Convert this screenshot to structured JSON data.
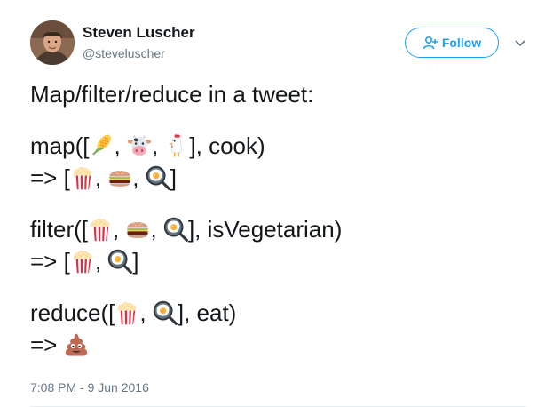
{
  "author": {
    "name": "Steven Luscher",
    "handle": "@steveluscher"
  },
  "follow_button": {
    "label": "Follow",
    "icon": "add-user-icon"
  },
  "menu_caret": {
    "icon": "chevron-down-icon"
  },
  "tweet": {
    "intro": "Map/filter/reduce in a tweet:",
    "map_prefix": "map([",
    "map_sep1": ",",
    "map_sep2": ",",
    "map_suffix": "], cook)",
    "map_result_prefix": "=> [",
    "map_result_sep1": ",",
    "map_result_sep2": ",",
    "map_result_suffix": "]",
    "filter_prefix": "filter([",
    "filter_sep1": ",",
    "filter_sep2": ",",
    "filter_suffix": "], isVegetarian)",
    "filter_result_prefix": "=>  [",
    "filter_result_sep1": ",",
    "filter_result_suffix": "]",
    "reduce_prefix": "reduce([",
    "reduce_sep1": ",",
    "reduce_suffix": "], eat)",
    "reduce_result_prefix": "=> ",
    "emojis": {
      "corn": "ear-of-corn-emoji",
      "cow": "cow-face-emoji",
      "chicken": "chicken-emoji",
      "popcorn": "popcorn-emoji",
      "hamburger": "hamburger-emoji",
      "egg": "fried-egg-in-pan-emoji",
      "poop": "pile-of-poo-emoji"
    }
  },
  "timestamp": "7:08 PM - 9 Jun 2016",
  "colors": {
    "accent": "#1da1f2",
    "text": "#14171a",
    "secondary": "#657786",
    "divider": "#e6ecf0"
  }
}
